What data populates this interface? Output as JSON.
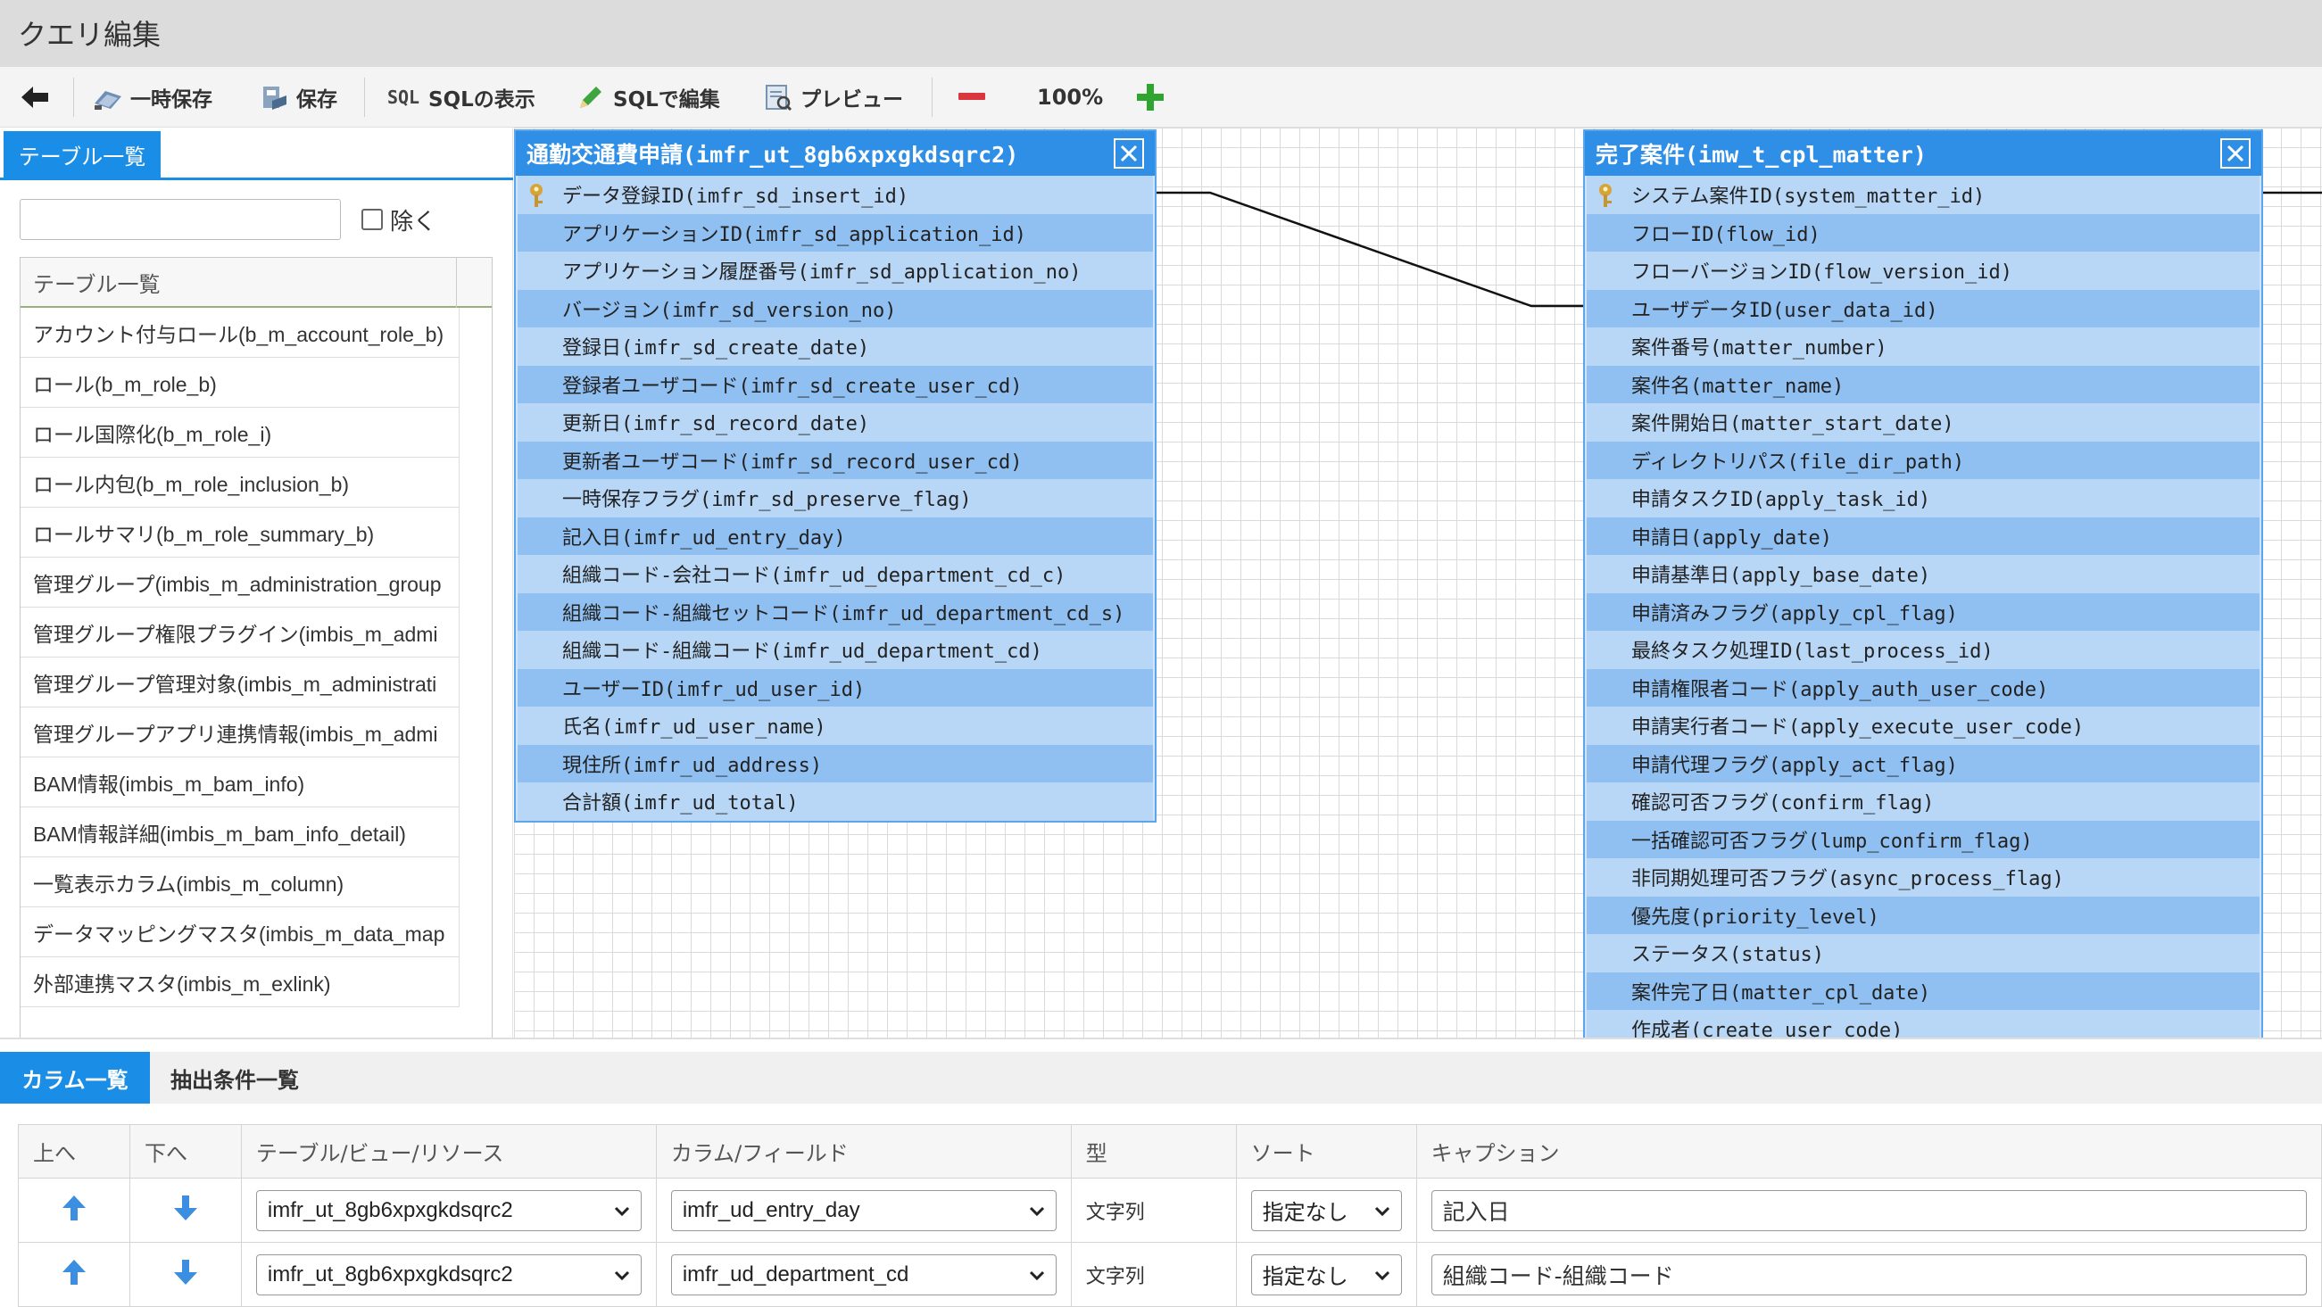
{
  "window": {
    "title": "クエリ編集"
  },
  "toolbar": {
    "back_label": "",
    "temp_save_label": "一時保存",
    "save_label": "保存",
    "show_sql_label": "SQLの表示",
    "edit_sql_label": "SQLで編集",
    "preview_label": "プレビュー",
    "zoom": "100%",
    "colors": {
      "minus": "#d9363e",
      "plus": "#2fa52f"
    }
  },
  "left": {
    "tab_label": "テーブル一覧",
    "search_placeholder": "",
    "exclude_label": "除く",
    "list_header": "テーブル一覧",
    "items": [
      "アカウント付与ロール(b_m_account_role_b)",
      "ロール(b_m_role_b)",
      "ロール国際化(b_m_role_i)",
      "ロール内包(b_m_role_inclusion_b)",
      "ロールサマリ(b_m_role_summary_b)",
      "管理グループ(imbis_m_administration_group",
      "管理グループ権限プラグイン(imbis_m_admi",
      "管理グループ管理対象(imbis_m_administrati",
      "管理グループアプリ連携情報(imbis_m_admi",
      "BAM情報(imbis_m_bam_info)",
      "BAM情報詳細(imbis_m_bam_info_detail)",
      "一覧表示カラム(imbis_m_column)",
      "データマッピングマスタ(imbis_m_data_map",
      "外部連携マスタ(imbis_m_exlink)"
    ]
  },
  "entities": [
    {
      "title": "通勤交通費申請(imfr_ut_8gb6xpxgkdsqrc2)",
      "fields": [
        "データ登録ID(imfr_sd_insert_id)",
        "アプリケーションID(imfr_sd_application_id)",
        "アプリケーション履歴番号(imfr_sd_application_no)",
        "バージョン(imfr_sd_version_no)",
        "登録日(imfr_sd_create_date)",
        "登録者ユーザコード(imfr_sd_create_user_cd)",
        "更新日(imfr_sd_record_date)",
        "更新者ユーザコード(imfr_sd_record_user_cd)",
        "一時保存フラグ(imfr_sd_preserve_flag)",
        "記入日(imfr_ud_entry_day)",
        "組織コード-会社コード(imfr_ud_department_cd_c)",
        "組織コード-組織セットコード(imfr_ud_department_cd_s)",
        "組織コード-組織コード(imfr_ud_department_cd)",
        "ユーザーID(imfr_ud_user_id)",
        "氏名(imfr_ud_user_name)",
        "現住所(imfr_ud_address)",
        "合計額(imfr_ud_total)"
      ]
    },
    {
      "title": "完了案件(imw_t_cpl_matter)",
      "fields": [
        "システム案件ID(system_matter_id)",
        "フローID(flow_id)",
        "フローバージョンID(flow_version_id)",
        "ユーザデータID(user_data_id)",
        "案件番号(matter_number)",
        "案件名(matter_name)",
        "案件開始日(matter_start_date)",
        "ディレクトリパス(file_dir_path)",
        "申請タスクID(apply_task_id)",
        "申請日(apply_date)",
        "申請基準日(apply_base_date)",
        "申請済みフラグ(apply_cpl_flag)",
        "最終タスク処理ID(last_process_id)",
        "申請権限者コード(apply_auth_user_code)",
        "申請実行者コード(apply_execute_user_code)",
        "申請代理フラグ(apply_act_flag)",
        "確認可否フラグ(confirm_flag)",
        "一括確認可否フラグ(lump_confirm_flag)",
        "非同期処理可否フラグ(async_process_flag)",
        "優先度(priority_level)",
        "ステータス(status)",
        "案件完了日(matter_cpl_date)",
        "作成者(create_user_code)"
      ]
    }
  ],
  "bottom": {
    "tabs": [
      "カラム一覧",
      "抽出条件一覧"
    ],
    "headers": [
      "上へ",
      "下へ",
      "テーブル/ビュー/リソース",
      "カラム/フィールド",
      "型",
      "ソート",
      "キャプション"
    ],
    "rows": [
      {
        "table": "imfr_ut_8gb6xpxgkdsqrc2",
        "column": "imfr_ud_entry_day",
        "type": "文字列",
        "sort": "指定なし",
        "caption": "記入日"
      },
      {
        "table": "imfr_ut_8gb6xpxgkdsqrc2",
        "column": "imfr_ud_department_cd",
        "type": "文字列",
        "sort": "指定なし",
        "caption": "組織コード-組織コード"
      }
    ]
  }
}
